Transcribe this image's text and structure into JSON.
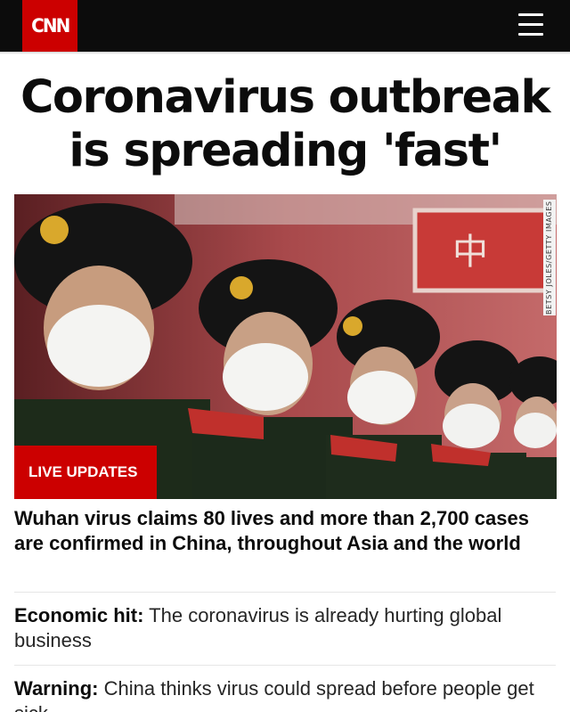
{
  "header": {
    "logo_text": "CNN",
    "brand_color": "#cc0000",
    "menu_icon": "hamburger-menu-icon"
  },
  "headline": {
    "line1": "Coronavirus outbreak",
    "line2": "is spreading 'fast'"
  },
  "hero": {
    "photo_credit": "BETSY JOLES/GETTY IMAGES",
    "badge": "LIVE UPDATES"
  },
  "top_story": {
    "title": "Wuhan virus claims 80 lives and more than 2,700 cases are confirmed in China, throughout Asia and the world"
  },
  "stories": [
    {
      "lead": "Economic hit:",
      "text": " The coronavirus is already hurting global business"
    },
    {
      "lead": "Warning:",
      "text": " China thinks virus could spread before people get sick"
    }
  ]
}
